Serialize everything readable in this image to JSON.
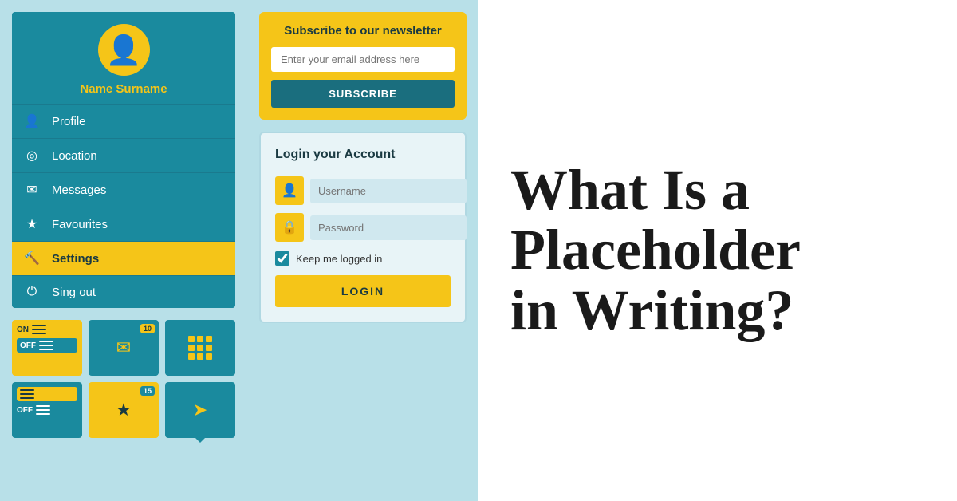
{
  "sidebar": {
    "user_name": "Name Surname",
    "menu_items": [
      {
        "label": "Profile",
        "icon": "👤",
        "active": false
      },
      {
        "label": "Location",
        "icon": "📍",
        "active": false
      },
      {
        "label": "Messages",
        "icon": "✉",
        "active": false
      },
      {
        "label": "Favourites",
        "icon": "★",
        "active": false
      },
      {
        "label": "Settings",
        "icon": "🔧",
        "active": true
      },
      {
        "label": "Sing out",
        "icon": "⏻",
        "active": false
      }
    ]
  },
  "widgets": {
    "on_label": "ON",
    "off_label": "OFF",
    "mail_badge": "10",
    "star_badge": "15"
  },
  "newsletter": {
    "title": "Subscribe to our newsletter",
    "input_placeholder": "Enter your email address here",
    "button_label": "SUBSCRIBE"
  },
  "login": {
    "title": "Login your Account",
    "username_placeholder": "Username",
    "password_placeholder": "Password",
    "remember_label": "Keep me logged in",
    "button_label": "LOGIN"
  },
  "article": {
    "heading_line1": "What Is a",
    "heading_line2": "Placeholder",
    "heading_line3": "in Writing?"
  },
  "colors": {
    "teal_dark": "#1a6e7e",
    "teal_mid": "#1a8a9e",
    "yellow": "#f5c518",
    "light_blue_bg": "#b8e0e8",
    "text_dark": "#1a3a42"
  }
}
